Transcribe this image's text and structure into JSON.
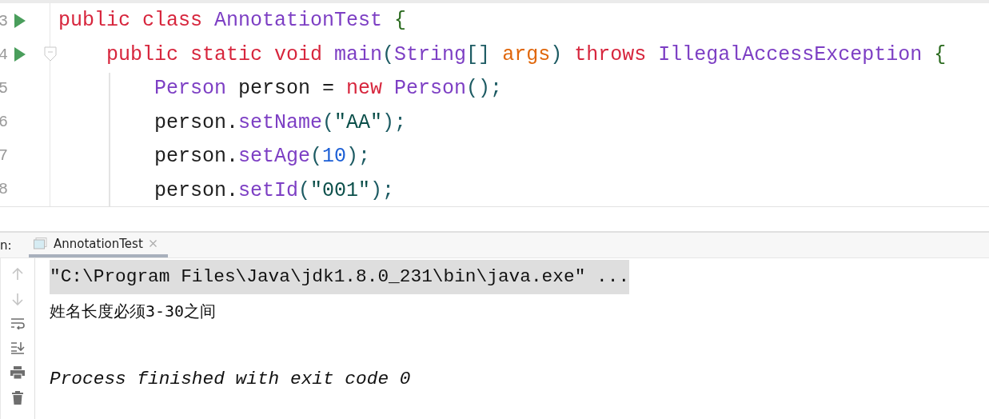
{
  "editor": {
    "lines": [
      {
        "number": "3",
        "runnable": true,
        "fold": false,
        "tokens": [
          {
            "kind": "keyword",
            "text": "public class "
          },
          {
            "kind": "type",
            "text": "AnnotationTest "
          },
          {
            "kind": "brace",
            "text": "{"
          }
        ]
      },
      {
        "number": "4",
        "runnable": true,
        "fold": true,
        "tokens": [
          {
            "kind": "keyword",
            "text": "    public static void "
          },
          {
            "kind": "method",
            "text": "main"
          },
          {
            "kind": "punct",
            "text": "("
          },
          {
            "kind": "type",
            "text": "String"
          },
          {
            "kind": "punct",
            "text": "[] "
          },
          {
            "kind": "param",
            "text": "args"
          },
          {
            "kind": "punct",
            "text": ") "
          },
          {
            "kind": "keyword",
            "text": "throws "
          },
          {
            "kind": "type",
            "text": "IllegalAccessException "
          },
          {
            "kind": "brace",
            "text": "{"
          }
        ]
      },
      {
        "number": "5",
        "runnable": false,
        "fold": false,
        "tokens": [
          {
            "kind": "type",
            "text": "        Person "
          },
          {
            "kind": "plain",
            "text": "person = "
          },
          {
            "kind": "keyword",
            "text": "new "
          },
          {
            "kind": "type",
            "text": "Person"
          },
          {
            "kind": "punct",
            "text": "();"
          }
        ]
      },
      {
        "number": "6",
        "runnable": false,
        "fold": false,
        "tokens": [
          {
            "kind": "plain",
            "text": "        person."
          },
          {
            "kind": "method",
            "text": "setName"
          },
          {
            "kind": "punct",
            "text": "("
          },
          {
            "kind": "string",
            "text": "\"AA\""
          },
          {
            "kind": "punct",
            "text": ");"
          }
        ]
      },
      {
        "number": "7",
        "runnable": false,
        "fold": false,
        "tokens": [
          {
            "kind": "plain",
            "text": "        person."
          },
          {
            "kind": "method",
            "text": "setAge"
          },
          {
            "kind": "punct",
            "text": "("
          },
          {
            "kind": "number",
            "text": "10"
          },
          {
            "kind": "punct",
            "text": ");"
          }
        ]
      },
      {
        "number": "8",
        "runnable": false,
        "fold": false,
        "tokens": [
          {
            "kind": "plain",
            "text": "        person."
          },
          {
            "kind": "method",
            "text": "setId"
          },
          {
            "kind": "punct",
            "text": "("
          },
          {
            "kind": "string",
            "text": "\"001\""
          },
          {
            "kind": "punct",
            "text": ");"
          }
        ]
      }
    ]
  },
  "run_panel": {
    "label": "n:",
    "tabs": [
      {
        "label": "AnnotationTest",
        "selected": true,
        "closable": true
      }
    ],
    "output": [
      {
        "kind": "command",
        "text": "\"C:\\Program Files\\Java\\jdk1.8.0_231\\bin\\java.exe\" ..."
      },
      {
        "kind": "stdout",
        "text": "姓名长度必须3-30之间"
      },
      {
        "kind": "exit",
        "text": "Process finished with exit code 0"
      }
    ]
  }
}
